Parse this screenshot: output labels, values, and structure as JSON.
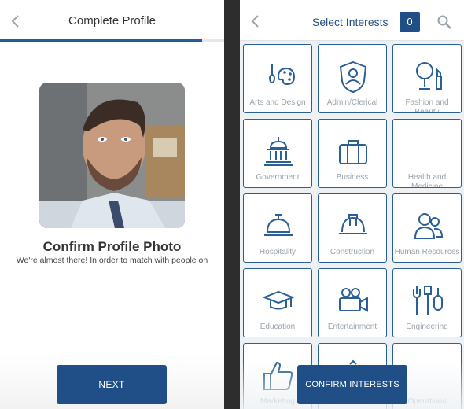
{
  "left": {
    "title": "Complete Profile",
    "progress": 0.9,
    "confirm_title": "Confirm Profile Photo",
    "confirm_subtitle": "We're almost there! In order to match with people on",
    "next_label": "NEXT"
  },
  "right": {
    "title": "Select Interests",
    "count": "0",
    "confirm_label": "CONFIRM INTERESTS",
    "tiles": [
      {
        "label": "Arts and Design",
        "icon": "palette-icon"
      },
      {
        "label": "Admin/Clerical",
        "icon": "admin-badge-icon"
      },
      {
        "label": "Fashion and Beauty",
        "icon": "mirror-lipstick-icon"
      },
      {
        "label": "Government",
        "icon": "capitol-building-icon"
      },
      {
        "label": "Business",
        "icon": "briefcase-icon"
      },
      {
        "label": "Health and Medicine",
        "icon": "health-icon"
      },
      {
        "label": "Hospitality",
        "icon": "service-bell-icon"
      },
      {
        "label": "Construction",
        "icon": "hard-hat-icon"
      },
      {
        "label": "Human Resources",
        "icon": "people-icon"
      },
      {
        "label": "Education",
        "icon": "graduation-cap-icon"
      },
      {
        "label": "Entertainment",
        "icon": "video-camera-icon"
      },
      {
        "label": "Engineering",
        "icon": "tools-icon"
      },
      {
        "label": "Marketing",
        "icon": "thumbs-up-icon"
      },
      {
        "label": "",
        "icon": "unknown-icon"
      },
      {
        "label": "Operations",
        "icon": "operations-icon"
      }
    ]
  },
  "colors": {
    "accent": "#1f4f86",
    "tile_border": "#2b5f97",
    "label_gray": "#9aa3ab"
  }
}
